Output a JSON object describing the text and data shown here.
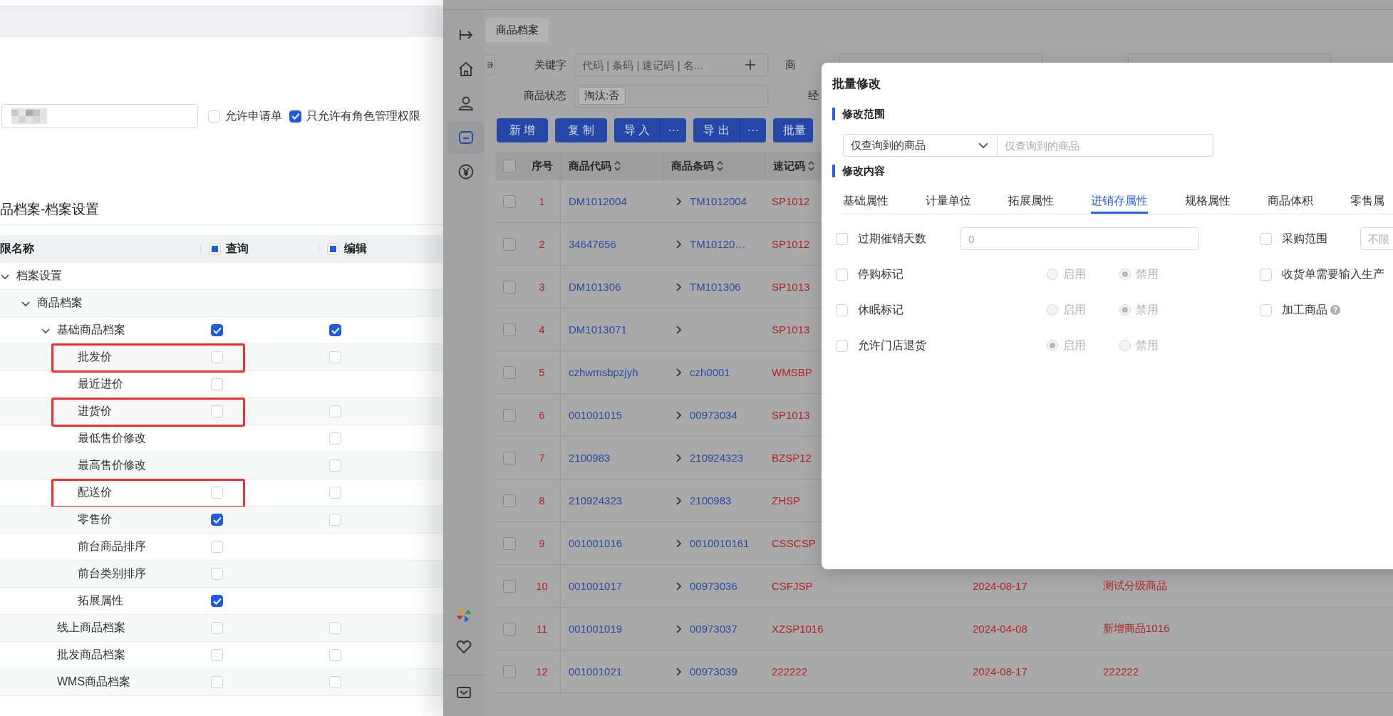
{
  "permissions": {
    "options": [
      {
        "label": "允许申请单",
        "checked": false
      },
      {
        "label": "只允许有角色管理权限",
        "checked": true
      }
    ],
    "section_title": "品档案-档案设置",
    "columns": [
      {
        "label": "限名称"
      },
      {
        "label": "查询",
        "indeterminate": true
      },
      {
        "label": "编辑",
        "indeterminate": true
      }
    ],
    "tree": [
      {
        "label": "档案设置",
        "expanded": true,
        "highlighted": false,
        "children": [
          {
            "label": "商品档案",
            "expanded": true,
            "highlighted": false,
            "children": [
              {
                "label": "基础商品档案",
                "expanded": true,
                "highlighted": false,
                "query": true,
                "edit": true,
                "children": [
                  {
                    "label": "批发价",
                    "highlighted": true,
                    "query": false,
                    "edit": false
                  },
                  {
                    "label": "最近进价",
                    "highlighted": false,
                    "query": false
                  },
                  {
                    "label": "进货价",
                    "highlighted": true,
                    "query": false,
                    "edit": false
                  },
                  {
                    "label": "最低售价修改",
                    "highlighted": false,
                    "edit": false
                  },
                  {
                    "label": "最高售价修改",
                    "highlighted": false,
                    "edit": false
                  },
                  {
                    "label": "配送价",
                    "highlighted": true,
                    "query": false,
                    "edit": false
                  },
                  {
                    "label": "零售价",
                    "highlighted": false,
                    "query": true,
                    "edit": false
                  },
                  {
                    "label": "前台商品排序",
                    "highlighted": false,
                    "query": false
                  },
                  {
                    "label": "前台类别排序",
                    "highlighted": false,
                    "query": false
                  },
                  {
                    "label": "拓展属性",
                    "highlighted": false,
                    "query": true
                  }
                ]
              },
              {
                "label": "线上商品档案",
                "highlighted": false,
                "query": false,
                "edit": false
              },
              {
                "label": "批发商品档案",
                "highlighted": false,
                "query": false,
                "edit": false
              },
              {
                "label": "WMS商品档案",
                "highlighted": false,
                "query": false,
                "edit": false
              }
            ]
          }
        ]
      }
    ]
  },
  "app": {
    "sidebar": [
      {
        "selected": false
      },
      {
        "selected": false
      },
      {
        "selected": false
      },
      {
        "selected": true
      },
      {
        "selected": false
      }
    ],
    "tab": {
      "label": "商品档案",
      "selected": true
    },
    "filters": {
      "keyword_label": "关键字",
      "keyword_placeholder": "代码 | 条码 | 速记码 | 名...",
      "status_label": "商品状态",
      "status_tag": "淘汰:否",
      "label_3": "商",
      "label_4": "经"
    },
    "buttons": [
      {
        "kind": "plain",
        "label": "新 增"
      },
      {
        "kind": "plain",
        "label": "复 制"
      },
      {
        "kind": "split",
        "label": "导 入",
        "more": "···"
      },
      {
        "kind": "split",
        "label": "导 出",
        "more": "···"
      },
      {
        "kind": "plain",
        "label": "批量"
      }
    ],
    "table": {
      "all_selected": false,
      "columns": [
        {
          "label": "序号",
          "sortable": false
        },
        {
          "label": "商品代码",
          "sortable": true
        },
        {
          "label": "商品条码",
          "sortable": true
        },
        {
          "label": "速记码",
          "sortable": true
        }
      ],
      "rows": [
        {
          "selected": false,
          "index": "1",
          "code": "DM1012004",
          "barcode": "TM1012004",
          "quick_code": "SP1012"
        },
        {
          "selected": false,
          "index": "2",
          "code": "34647656",
          "barcode": "TM10120…",
          "quick_code": "SP1012"
        },
        {
          "selected": false,
          "index": "3",
          "code": "DM101306",
          "barcode": "TM101306",
          "quick_code": "SP1013"
        },
        {
          "selected": false,
          "index": "4",
          "code": "DM1013071",
          "quick_code": "SP1013"
        },
        {
          "selected": false,
          "index": "5",
          "code": "czhwmsbpzjyh",
          "barcode": "czh0001",
          "quick_code": "WMSBP"
        },
        {
          "selected": false,
          "index": "6",
          "code": "001001015",
          "barcode": "00973034",
          "quick_code": "SP1013"
        },
        {
          "selected": false,
          "index": "7",
          "code": "2100983",
          "barcode": "210924323",
          "quick_code": "BZSP12"
        },
        {
          "selected": false,
          "index": "8",
          "code": "210924323",
          "barcode": "2100983",
          "quick_code": "ZHSP"
        },
        {
          "selected": false,
          "index": "9",
          "code": "001001016",
          "barcode": "0010010161",
          "quick_code": "CSSCSP"
        },
        {
          "selected": false,
          "index": "10",
          "code": "001001017",
          "barcode": "00973036",
          "quick_code": "CSFJSP",
          "date": "2024-08-17",
          "name": "测试分级商品"
        },
        {
          "selected": false,
          "index": "11",
          "code": "001001019",
          "barcode": "00973037",
          "quick_code": "XZSP1016",
          "date": "2024-04-08",
          "name": "新增商品1016"
        },
        {
          "selected": false,
          "index": "12",
          "code": "001001021",
          "barcode": "00973039",
          "quick_code": "222222",
          "date": "2024-08-17",
          "name": "222222"
        }
      ]
    }
  },
  "dialog": {
    "title": "批量修改",
    "scope_heading": "修改范围",
    "scope_select": "仅查询到的商品",
    "scope_placeholder": "仅查询到的商品",
    "content_heading": "修改内容",
    "tabs": [
      {
        "label": "基础属性",
        "selected": false
      },
      {
        "label": "计量单位",
        "selected": false
      },
      {
        "label": "拓展属性",
        "selected": false
      },
      {
        "label": "进销存属性",
        "selected": true
      },
      {
        "label": "规格属性",
        "selected": false
      },
      {
        "label": "商品体积",
        "selected": false
      },
      {
        "label": "零售属",
        "selected": false
      }
    ],
    "fields": [
      {
        "kind": "input",
        "label": "过期催销天数",
        "checked": false,
        "placeholder": "0"
      },
      {
        "kind": "radio",
        "label": "停购标记",
        "checked": false,
        "disabled": true,
        "options": [
          {
            "label": "启用",
            "selected": false
          },
          {
            "label": "禁用",
            "selected": true
          }
        ]
      },
      {
        "kind": "radio",
        "label": "休眠标记",
        "checked": false,
        "disabled": true,
        "options": [
          {
            "label": "启用",
            "selected": false
          },
          {
            "label": "禁用",
            "selected": true
          }
        ]
      },
      {
        "kind": "radio",
        "label": "允许门店退货",
        "checked": false,
        "disabled": true,
        "options": [
          {
            "label": "启用",
            "selected": true
          },
          {
            "label": "禁用",
            "selected": false
          }
        ]
      }
    ],
    "side_fields": [
      {
        "kind": "input",
        "label": "采购范围",
        "checked": false,
        "placeholder": "不限"
      },
      {
        "kind": "plain",
        "label": "收货单需要输入生产",
        "checked": false
      },
      {
        "kind": "help",
        "label": "加工商品",
        "checked": false,
        "mark": "?"
      }
    ]
  }
}
